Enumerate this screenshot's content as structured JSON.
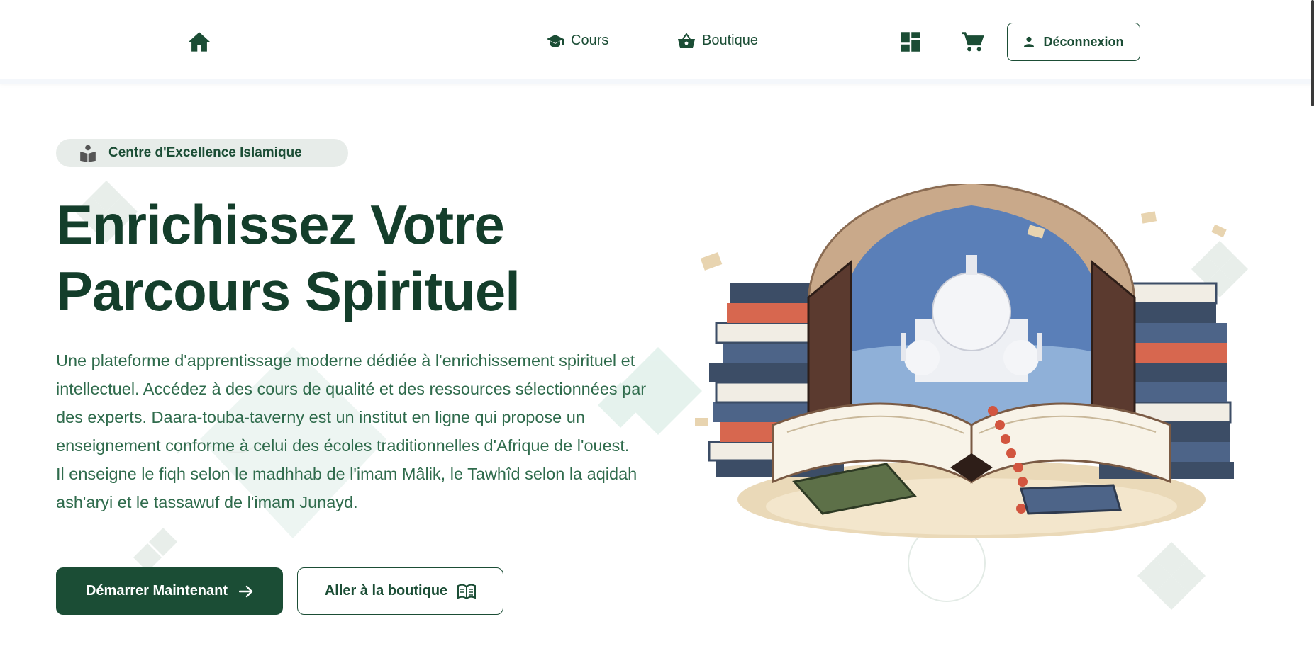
{
  "header": {
    "home_icon": "home-icon",
    "nav": [
      {
        "label": "Cours",
        "icon": "graduation-cap-icon"
      },
      {
        "label": "Boutique",
        "icon": "shopping-basket-icon"
      }
    ],
    "dashboard_icon": "dashboard-icon",
    "cart_icon": "cart-icon",
    "logout_label": "Déconnexion",
    "logout_icon": "user-icon"
  },
  "hero": {
    "badge_label": "Centre d'Excellence Islamique",
    "badge_icon": "reading-book-icon",
    "title_line1": "Enrichissez Votre",
    "title_line2": "Parcours Spirituel",
    "description_p1": "Une plateforme d'apprentissage moderne dédiée à l'enrichissement spirituel et intellectuel. Accédez à des cours de qualité et des ressources sélectionnées par des experts. Daara-touba-taverny est un institut en ligne qui propose un enseignement conforme à celui des écoles traditionnelles d'Afrique de l'ouest.",
    "description_p2": "Il enseigne le fiqh selon le madhhab de l'imam Mâlik, le Tawhîd selon la aqidah ash'aryi et le tassawuf de l'imam Junayd.",
    "cta_primary": "Démarrer Maintenant",
    "cta_secondary": "Aller à la boutique"
  },
  "colors": {
    "primary": "#1b4d35",
    "title": "#143e2b",
    "text": "#2f6b4c",
    "badge_bg": "#e7ece9"
  }
}
